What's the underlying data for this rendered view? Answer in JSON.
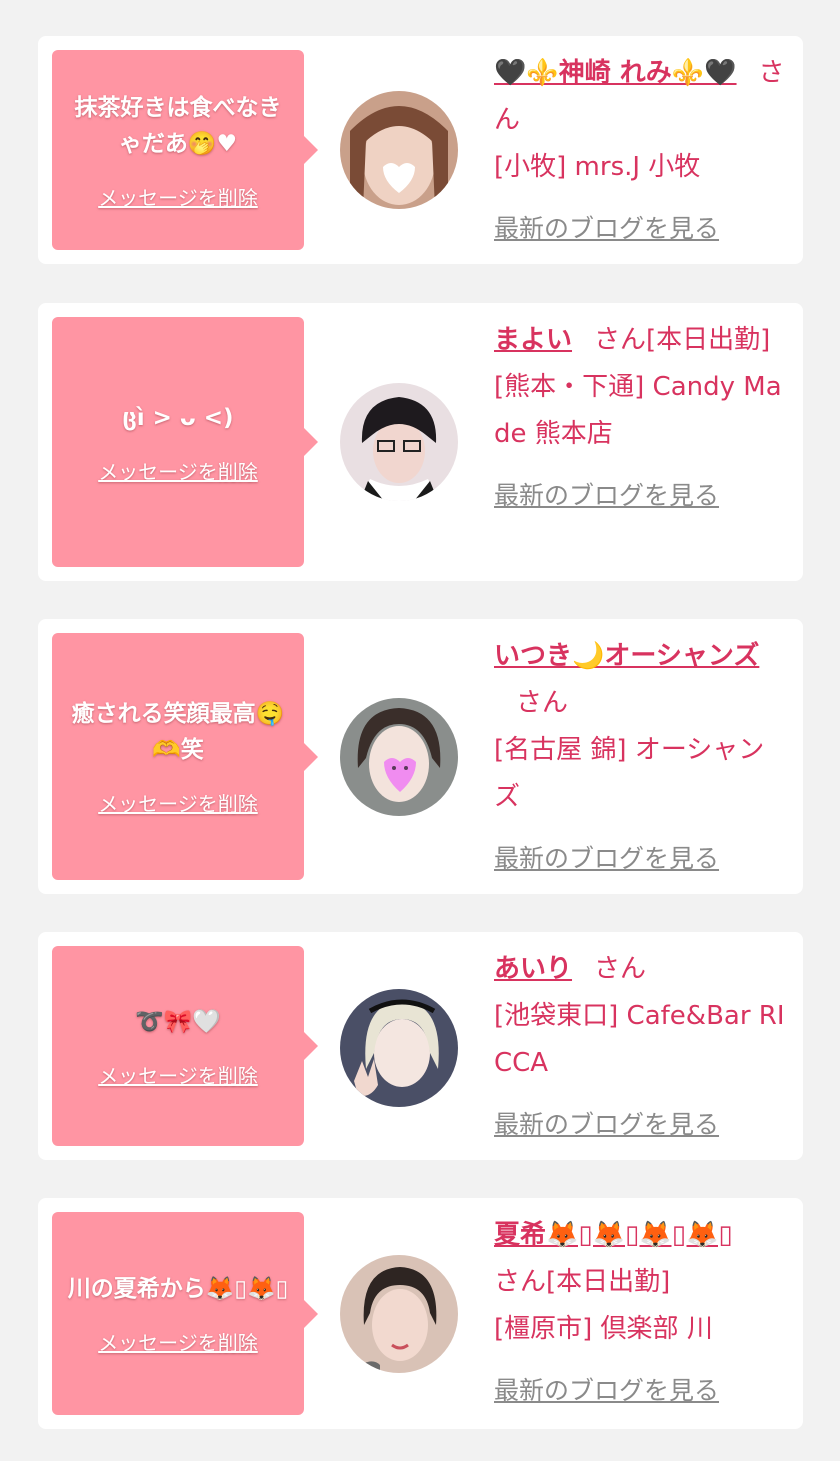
{
  "common": {
    "delete_label": "メッセージを削除",
    "blog_label": "最新のブログを見る",
    "san_label": "さん"
  },
  "cards": [
    {
      "message": "抹茶好きは食べなきゃだあ🤭♥",
      "name": "🖤⚜️神崎 れみ⚜️🖤",
      "suffix": "さん",
      "shop": "[小牧] mrs.J 小牧",
      "avatar_icon": "avatar-photo-icon"
    },
    {
      "message": "ცı̀ > ᴗ <)",
      "name": "まよい",
      "suffix": "さん[本日出勤]",
      "shop": "[熊本・下通] Candy Made 熊本店",
      "avatar_icon": "avatar-photo-icon"
    },
    {
      "message": "癒される笑顔最高🤤🫶笑",
      "name": "いつき🌙オーシャンズ",
      "suffix": "さん",
      "shop": "[名古屋 錦] オーシャンズ",
      "avatar_icon": "avatar-photo-icon"
    },
    {
      "message": "➰🎀🤍",
      "name": "あいり",
      "suffix": "さん",
      "shop": "[池袋東口] Cafe&Bar RICCA",
      "avatar_icon": "avatar-photo-icon"
    },
    {
      "message": "川の夏希から🦊▯🦊▯",
      "name": "夏希🦊▯🦊▯🦊▯🦊▯",
      "suffix": "さん[本日出勤]",
      "shop": "[橿原市] 倶楽部 川",
      "avatar_icon": "avatar-photo-icon"
    }
  ],
  "colors": {
    "bubble": "#ff95a3",
    "accent": "#d8335f",
    "link_gray": "#8a8a8a",
    "background": "#f2f2f2"
  }
}
